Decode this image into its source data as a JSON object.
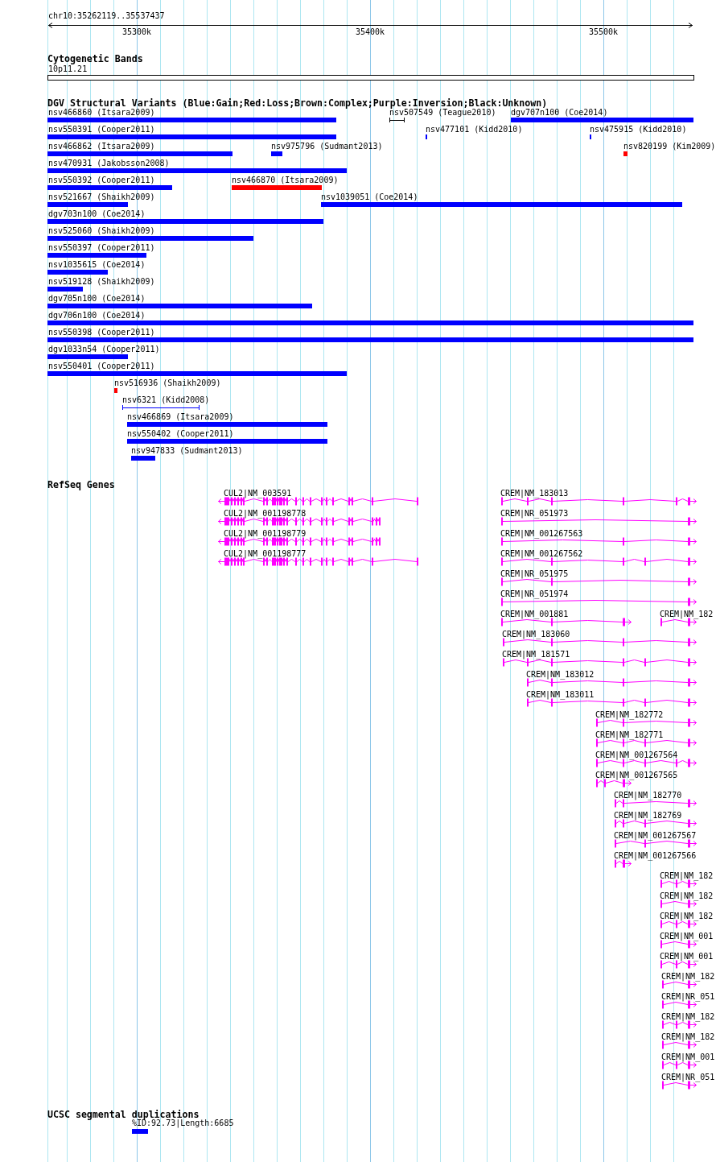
{
  "ruler": {
    "title": "chr10:35262119..35537437",
    "ticks": [
      "35300k",
      "35400k",
      "35500k"
    ]
  },
  "cytogenetic_bands": {
    "title": "Cytogenetic Bands",
    "features": [
      {
        "label": "10p11.21"
      }
    ]
  },
  "dgv_structural_variants": {
    "title": "DGV Structural Variants (Blue:Gain;Red:Loss;Brown:Complex;Purple:Inversion;Black:Unknown)",
    "rows": [
      {
        "features": [
          {
            "label": "nsv466860 (Itsara2009)",
            "kind": "block",
            "color": "#0000ff"
          },
          {
            "label": "nsv507549 (Teague2010)",
            "kind": "span",
            "color": "#000000"
          },
          {
            "label": "dgv707n100 (Coe2014)",
            "kind": "block",
            "color": "#0000ff"
          }
        ]
      },
      {
        "features": [
          {
            "label": "nsv550391 (Cooper2011)",
            "kind": "block",
            "color": "#0000ff"
          },
          {
            "label": "nsv477101 (Kidd2010)",
            "kind": "block",
            "color": "#0000ff"
          },
          {
            "label": "nsv475915 (Kidd2010)",
            "kind": "block",
            "color": "#0000ff"
          }
        ]
      },
      {
        "features": [
          {
            "label": "nsv466862 (Itsara2009)",
            "kind": "block",
            "color": "#0000ff"
          },
          {
            "label": "nsv975796 (Sudmant2013)",
            "kind": "block",
            "color": "#0000ff"
          },
          {
            "label": "nsv820199 (Kim2009)",
            "kind": "block",
            "color": "#ff0000"
          }
        ]
      },
      {
        "features": [
          {
            "label": "nsv470931 (Jakobsson2008)",
            "kind": "block",
            "color": "#0000ff"
          }
        ]
      },
      {
        "features": [
          {
            "label": "nsv550392 (Cooper2011)",
            "kind": "block",
            "color": "#0000ff"
          },
          {
            "label": "nsv466870 (Itsara2009)",
            "kind": "block",
            "color": "#ff0000"
          }
        ]
      },
      {
        "features": [
          {
            "label": "nsv521667 (Shaikh2009)",
            "kind": "block",
            "color": "#0000ff"
          },
          {
            "label": "nsv1039051 (Coe2014)",
            "kind": "block",
            "color": "#0000ff"
          }
        ]
      },
      {
        "features": [
          {
            "label": "dgv703n100 (Coe2014)",
            "kind": "block",
            "color": "#0000ff"
          }
        ]
      },
      {
        "features": [
          {
            "label": "nsv525060 (Shaikh2009)",
            "kind": "block",
            "color": "#0000ff"
          }
        ]
      },
      {
        "features": [
          {
            "label": "nsv550397 (Cooper2011)",
            "kind": "block",
            "color": "#0000ff"
          }
        ]
      },
      {
        "features": [
          {
            "label": "nsv1035615 (Coe2014)",
            "kind": "block",
            "color": "#0000ff"
          }
        ]
      },
      {
        "features": [
          {
            "label": "nsv519128 (Shaikh2009)",
            "kind": "block",
            "color": "#0000ff"
          }
        ]
      },
      {
        "features": [
          {
            "label": "dgv705n100 (Coe2014)",
            "kind": "block",
            "color": "#0000ff"
          }
        ]
      },
      {
        "features": [
          {
            "label": "dgv706n100 (Coe2014)",
            "kind": "block",
            "color": "#0000ff"
          }
        ]
      },
      {
        "features": [
          {
            "label": "nsv550398 (Cooper2011)",
            "kind": "block",
            "color": "#0000ff"
          }
        ]
      },
      {
        "features": [
          {
            "label": "dgv1033n54 (Cooper2011)",
            "kind": "block",
            "color": "#0000ff"
          }
        ]
      },
      {
        "features": [
          {
            "label": "nsv550401 (Cooper2011)",
            "kind": "block",
            "color": "#0000ff"
          }
        ]
      },
      {
        "features": [
          {
            "label": "nsv516936 (Shaikh2009)",
            "kind": "block",
            "color": "#ff0000"
          }
        ]
      },
      {
        "features": [
          {
            "label": "nsv6321 (Kidd2008)",
            "kind": "span",
            "color": "#0000ff"
          }
        ]
      },
      {
        "features": [
          {
            "label": "nsv466869 (Itsara2009)",
            "kind": "block",
            "color": "#0000ff"
          }
        ]
      },
      {
        "features": [
          {
            "label": "nsv550402 (Cooper2011)",
            "kind": "block",
            "color": "#0000ff"
          }
        ]
      },
      {
        "features": [
          {
            "label": "nsv947833 (Sudmant2013)",
            "kind": "block",
            "color": "#0000ff"
          }
        ]
      }
    ]
  },
  "refseq_genes": {
    "title": "RefSeq Genes",
    "rows": [
      {
        "features": [
          {
            "label": "CUL2|NM_003591",
            "reverse_strand": true
          },
          {
            "label": "CREM|NM_183013",
            "reverse_strand": false
          }
        ]
      },
      {
        "features": [
          {
            "label": "CUL2|NM_001198778",
            "reverse_strand": true
          },
          {
            "label": "CREM|NR_051973",
            "reverse_strand": false
          }
        ]
      },
      {
        "features": [
          {
            "label": "CUL2|NM_001198779",
            "reverse_strand": true
          },
          {
            "label": "CREM|NM_001267563",
            "reverse_strand": false
          }
        ]
      },
      {
        "features": [
          {
            "label": "CUL2|NM_001198777",
            "reverse_strand": true
          },
          {
            "label": "CREM|NM_001267562",
            "reverse_strand": false
          }
        ]
      },
      {
        "features": [
          {
            "label": "CREM|NR_051975",
            "reverse_strand": false
          }
        ]
      },
      {
        "features": [
          {
            "label": "CREM|NR_051974",
            "reverse_strand": false
          }
        ]
      },
      {
        "features": [
          {
            "label": "CREM|NM_001881",
            "reverse_strand": false
          },
          {
            "label": "CREM|NM_182",
            "reverse_strand": false
          }
        ]
      },
      {
        "features": [
          {
            "label": "CREM|NM_183060",
            "reverse_strand": false
          }
        ]
      },
      {
        "features": [
          {
            "label": "CREM|NM_181571",
            "reverse_strand": false
          }
        ]
      },
      {
        "features": [
          {
            "label": "CREM|NM_183012",
            "reverse_strand": false
          }
        ]
      },
      {
        "features": [
          {
            "label": "CREM|NM_183011",
            "reverse_strand": false
          }
        ]
      },
      {
        "features": [
          {
            "label": "CREM|NM_182772",
            "reverse_strand": false
          }
        ]
      },
      {
        "features": [
          {
            "label": "CREM|NM_182771",
            "reverse_strand": false
          }
        ]
      },
      {
        "features": [
          {
            "label": "CREM|NM_001267564",
            "reverse_strand": false
          }
        ]
      },
      {
        "features": [
          {
            "label": "CREM|NM_001267565",
            "reverse_strand": false
          }
        ]
      },
      {
        "features": [
          {
            "label": "CREM|NM_182770",
            "reverse_strand": false
          }
        ]
      },
      {
        "features": [
          {
            "label": "CREM|NM_182769",
            "reverse_strand": false
          }
        ]
      },
      {
        "features": [
          {
            "label": "CREM|NM_001267567",
            "reverse_strand": false
          }
        ]
      },
      {
        "features": [
          {
            "label": "CREM|NM_001267566",
            "reverse_strand": false
          }
        ]
      },
      {
        "features": [
          {
            "label": "CREM|NM_182",
            "reverse_strand": false
          }
        ]
      },
      {
        "features": [
          {
            "label": "CREM|NM_182",
            "reverse_strand": false
          }
        ]
      },
      {
        "features": [
          {
            "label": "CREM|NM_182",
            "reverse_strand": false
          }
        ]
      },
      {
        "features": [
          {
            "label": "CREM|NM_001",
            "reverse_strand": false
          }
        ]
      },
      {
        "features": [
          {
            "label": "CREM|NM_001",
            "reverse_strand": false
          }
        ]
      },
      {
        "features": [
          {
            "label": "CREM|NM_182",
            "reverse_strand": false
          }
        ]
      },
      {
        "features": [
          {
            "label": "CREM|NR_051",
            "reverse_strand": false
          }
        ]
      },
      {
        "features": [
          {
            "label": "CREM|NM_182",
            "reverse_strand": false
          }
        ]
      },
      {
        "features": [
          {
            "label": "CREM|NM_182",
            "reverse_strand": false
          }
        ]
      },
      {
        "features": [
          {
            "label": "CREM|NM_001",
            "reverse_strand": false
          }
        ]
      },
      {
        "features": [
          {
            "label": "CREM|NR_051",
            "reverse_strand": false
          }
        ]
      }
    ]
  },
  "segmental_duplications": {
    "title": "UCSC segmental duplications",
    "features": [
      {
        "label": "%ID:92.73|Length:6685"
      }
    ]
  }
}
